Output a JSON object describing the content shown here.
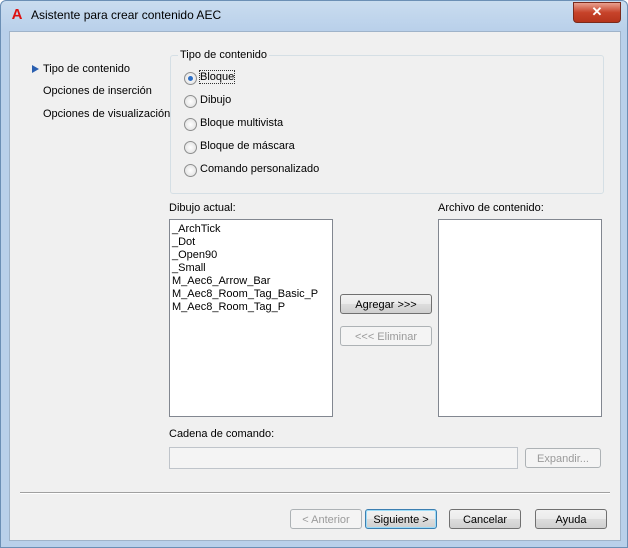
{
  "window": {
    "title": "Asistente para crear contenido AEC",
    "close_glyph": "✕",
    "app_icon_glyph": "A"
  },
  "nav": {
    "items": [
      "Tipo de contenido",
      "Opciones de inserción",
      "Opciones de visualización"
    ]
  },
  "content_type": {
    "group_title": "Tipo de contenido",
    "options": [
      "Bloque",
      "Dibujo",
      "Bloque multivista",
      "Bloque de máscara",
      "Comando personalizado"
    ],
    "selected": "Bloque"
  },
  "current_drawing": {
    "label": "Dibujo actual:",
    "items": [
      "_ArchTick",
      "_Dot",
      "_Open90",
      "_Small",
      "M_Aec6_Arrow_Bar",
      "M_Aec8_Room_Tag_Basic_P",
      "M_Aec8_Room_Tag_P"
    ]
  },
  "content_file": {
    "label": "Archivo de contenido:",
    "items": []
  },
  "transfer": {
    "add_label": "Agregar >>>",
    "remove_label": "<<< Eliminar"
  },
  "command": {
    "label": "Cadena de comando:",
    "value": "",
    "expand_label": "Expandir..."
  },
  "footer": {
    "back_label": "< Anterior",
    "next_label": "Siguiente >",
    "cancel_label": "Cancelar",
    "help_label": "Ayuda"
  }
}
